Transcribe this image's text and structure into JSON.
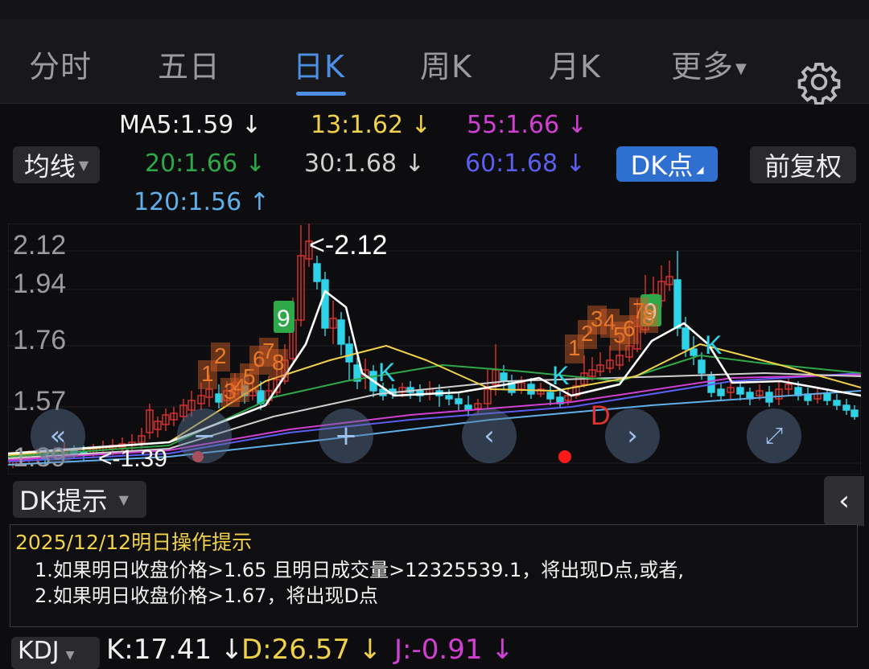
{
  "tabs": [
    {
      "label": "分时"
    },
    {
      "label": "五日"
    },
    {
      "label": "日K",
      "active": true
    },
    {
      "label": "周K"
    },
    {
      "label": "月K"
    },
    {
      "label": "更多"
    }
  ],
  "indicator_select": {
    "label": "均线"
  },
  "ma": {
    "ma5": {
      "text": "MA5:1.59 ↓",
      "color": "#f2f2f2"
    },
    "ma13": {
      "text": "13:1.62 ↓",
      "color": "#f0d24a"
    },
    "ma55": {
      "text": "55:1.66 ↓",
      "color": "#d23fd3"
    },
    "ma20": {
      "text": "20:1.66 ↓",
      "color": "#2fa84a"
    },
    "ma30": {
      "text": "30:1.68 ↓",
      "color": "#cfcfcf"
    },
    "ma60": {
      "text": "60:1.68 ↓",
      "color": "#5b5ef0"
    },
    "ma120": {
      "text": "120:1.56 ↑",
      "color": "#5fb0ea"
    }
  },
  "dk_button": {
    "label": "DK点"
  },
  "fq_button": {
    "label": "前复权"
  },
  "chart_data": {
    "type": "candlestick",
    "y_ticks": [
      "2.12",
      "1.94",
      "1.76",
      "1.57",
      "1.39"
    ],
    "ylim": [
      1.39,
      2.12
    ],
    "max_label": "<-2.12",
    "min_label": "<-1.39",
    "signal_labels": {
      "nine": "9",
      "k": "K",
      "d": "D"
    },
    "count_digits": [
      "1",
      "2",
      "3",
      "4",
      "5",
      "6",
      "7",
      "8"
    ],
    "colors": {
      "up": "#e0332e",
      "down": "#2fd3e8",
      "ma5": "#ffffff",
      "ma13": "#f0d24a",
      "ma20": "#2fa84a",
      "ma30": "#cfcfcf",
      "ma55": "#d23fd3",
      "ma60": "#5b5ef0",
      "ma120": "#5fb0ea"
    }
  },
  "nav_icons": [
    "double-left-icon",
    "minus-icon",
    "plus-icon",
    "left-icon",
    "right-icon",
    "expand-icon"
  ],
  "dk_hint": {
    "select_label": "DK提示",
    "title": "2025/12/12明日操作提示",
    "line1": "1.如果明日收盘价格>1.65 且明日成交量>12325539.1，将出现D点,或者,",
    "line2": "2.如果明日收盘价格>1.67，将出现D点"
  },
  "kdj": {
    "select_label": "KDJ",
    "k": "K:17.41 ↓",
    "d": "D:26.57 ↓",
    "j": "J:-0.91 ↓"
  }
}
